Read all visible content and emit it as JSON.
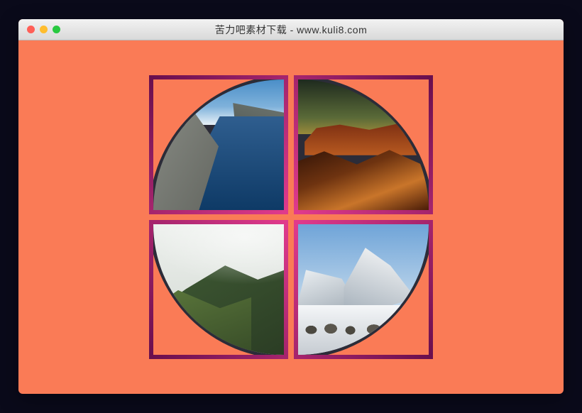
{
  "window": {
    "title": "苦力吧素材下载 - www.kuli8.com"
  },
  "quadrants": {
    "top_left": {
      "name": "fjord-landscape"
    },
    "top_right": {
      "name": "desert-rocks-sunset"
    },
    "bottom_left": {
      "name": "misty-green-ridge"
    },
    "bottom_right": {
      "name": "snowy-mountain-camp"
    }
  },
  "colors": {
    "page_bg": "#0a0a1a",
    "stage_bg": "#fa7b56",
    "border_accent": "#c71976"
  }
}
